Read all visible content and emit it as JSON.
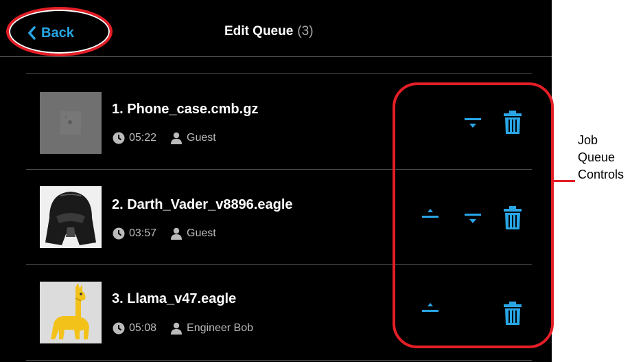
{
  "header": {
    "back_label": "Back",
    "title": "Edit Queue",
    "count": "(3)"
  },
  "jobs": [
    {
      "name": "1. Phone_case.cmb.gz",
      "time": "05:22",
      "user": "Guest",
      "controls": [
        "move-down",
        "delete"
      ]
    },
    {
      "name": "2. Darth_Vader_v8896.eagle",
      "time": "03:57",
      "user": "Guest",
      "controls": [
        "move-up",
        "move-down",
        "delete"
      ]
    },
    {
      "name": "3. Llama_v47.eagle",
      "time": "05:08",
      "user": "Engineer Bob",
      "controls": [
        "move-up",
        "delete"
      ]
    }
  ],
  "annotation": {
    "line1": "Job",
    "line2": "Queue",
    "line3": "Controls"
  },
  "colors": {
    "accent": "#29a6e6",
    "background": "#000000",
    "annotation": "#e41e26"
  },
  "icons": [
    "chevron-left-icon",
    "clock-icon",
    "user-icon",
    "move-up-icon",
    "move-down-icon",
    "trash-icon"
  ]
}
